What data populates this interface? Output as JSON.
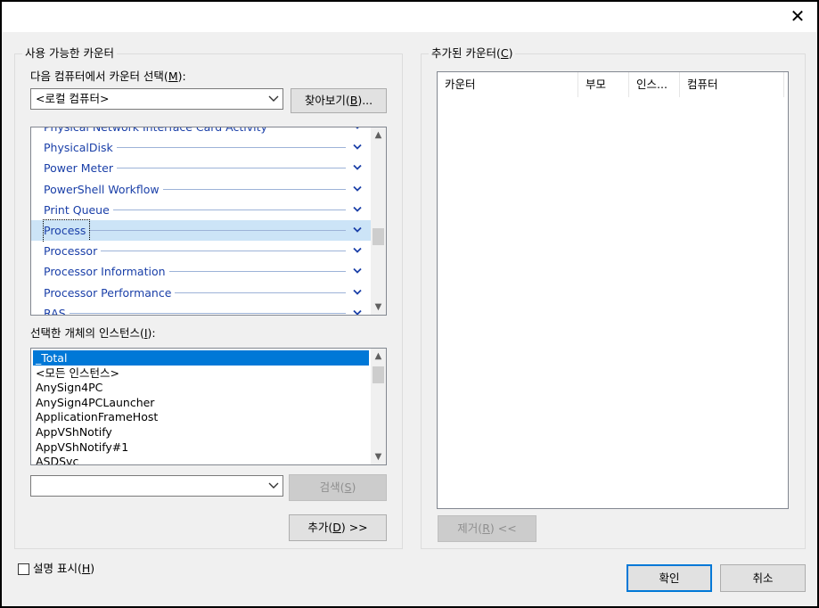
{
  "dialog": {
    "close_glyph": "✕"
  },
  "available": {
    "group_title": "사용 가능한 카운터",
    "computer_label_prefix": "다음 컴퓨터에서 카운터 선택(",
    "computer_label_key": "M",
    "computer_label_suffix": "):",
    "computer_value": "<로컬 컴퓨터>",
    "browse_button_prefix": "찾아보기(",
    "browse_button_key": "B",
    "browse_button_suffix": ")...",
    "objects": [
      {
        "name": "Physical Network Interface Card Activity",
        "partial": true,
        "selected": false
      },
      {
        "name": "PhysicalDisk",
        "selected": false
      },
      {
        "name": "Power Meter",
        "selected": false
      },
      {
        "name": "PowerShell Workflow",
        "selected": false
      },
      {
        "name": "Print Queue",
        "selected": false
      },
      {
        "name": "Process",
        "selected": true
      },
      {
        "name": "Processor",
        "selected": false
      },
      {
        "name": "Processor Information",
        "selected": false
      },
      {
        "name": "Processor Performance",
        "selected": false
      },
      {
        "name": "RAS",
        "partial": true,
        "selected": false
      }
    ],
    "instances_label_prefix": "선택한 개체의 인스턴스(",
    "instances_label_key": "I",
    "instances_label_suffix": "):",
    "instances": [
      {
        "name": "_Total",
        "selected": true
      },
      {
        "name": "<모든 인스턴스>",
        "selected": false
      },
      {
        "name": "AnySign4PC",
        "selected": false
      },
      {
        "name": "AnySign4PCLauncher",
        "selected": false
      },
      {
        "name": "ApplicationFrameHost",
        "selected": false
      },
      {
        "name": "AppVShNotify",
        "selected": false
      },
      {
        "name": "AppVShNotify#1",
        "selected": false
      },
      {
        "name": "ASDSvc",
        "selected": false
      }
    ],
    "search_value": "",
    "search_button_prefix": "검색(",
    "search_button_key": "S",
    "search_button_suffix": ")",
    "add_button_prefix": "추가(",
    "add_button_key": "D",
    "add_button_suffix": ") >>"
  },
  "added": {
    "group_title_prefix": "추가된 카운터(",
    "group_title_key": "C",
    "group_title_suffix": ")",
    "columns": [
      "카운터",
      "부모",
      "인스...",
      "컴퓨터"
    ],
    "remove_button_prefix": "제거(",
    "remove_button_key": "R",
    "remove_button_suffix": ") <<"
  },
  "footer": {
    "show_description_prefix": "설명 표시(",
    "show_description_key": "H",
    "show_description_suffix": ")",
    "show_description_checked": false,
    "ok_label": "확인",
    "cancel_label": "취소"
  },
  "colors": {
    "accent": "#0078d7",
    "object_text": "#1a3fa8",
    "selected_row": "#cce4f7",
    "dialog_bg": "#f0f0f0"
  }
}
